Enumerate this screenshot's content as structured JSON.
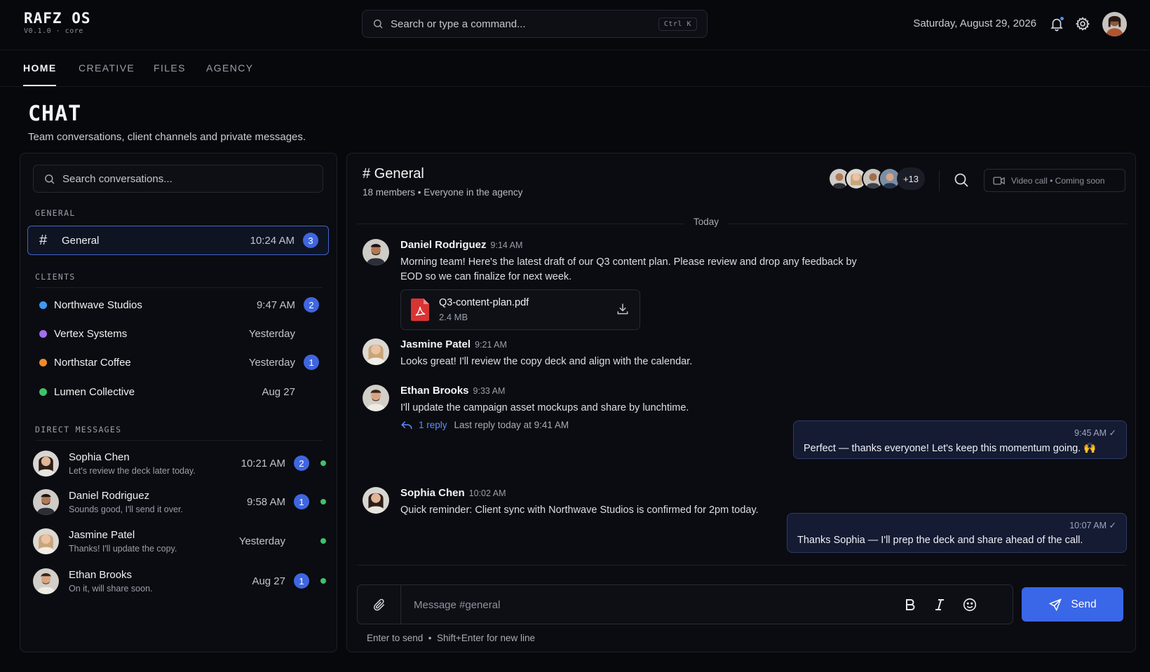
{
  "brand": {
    "name": "RAFZ OS",
    "version": "V0.1.0 · core"
  },
  "command_search": {
    "placeholder": "Search or type a command...",
    "shortcut": "Ctrl K"
  },
  "header": {
    "date": "Saturday, August 29, 2026"
  },
  "nav": {
    "tabs": [
      "HOME",
      "CREATIVE",
      "FILES",
      "AGENCY"
    ],
    "active": "HOME"
  },
  "page": {
    "title": "CHAT",
    "subtitle": "Team conversations, client channels and private messages."
  },
  "sidebar": {
    "search_placeholder": "Search conversations...",
    "sections": {
      "general": "GENERAL",
      "clients": "CLIENTS",
      "direct": "DIRECT MESSAGES"
    },
    "general": [
      {
        "name": "General",
        "time": "10:24 AM",
        "unread": "3"
      }
    ],
    "clients": [
      {
        "name": "Northwave Studios",
        "time": "9:47 AM",
        "unread": "2",
        "color": "#3d9bf0"
      },
      {
        "name": "Vertex Systems",
        "time": "Yesterday",
        "unread": "",
        "color": "#a46ff0"
      },
      {
        "name": "Northstar Coffee",
        "time": "Yesterday",
        "unread": "1",
        "color": "#f08a2b"
      },
      {
        "name": "Lumen Collective",
        "time": "Aug 27",
        "unread": "",
        "color": "#3ec268"
      }
    ],
    "direct": [
      {
        "name": "Sophia Chen",
        "preview": "Let's review the deck later today.",
        "time": "10:21 AM",
        "unread": "2"
      },
      {
        "name": "Daniel Rodriguez",
        "preview": "Sounds good, I'll send it over.",
        "time": "9:58 AM",
        "unread": "1"
      },
      {
        "name": "Jasmine Patel",
        "preview": "Thanks! I'll update the copy.",
        "time": "Yesterday",
        "unread": ""
      },
      {
        "name": "Ethan Brooks",
        "preview": "On it, will share soon.",
        "time": "Aug 27",
        "unread": "1"
      }
    ]
  },
  "channel": {
    "title": "# General",
    "subtitle": "18 members • Everyone in the agency",
    "extra_members": "+13",
    "video_call": "Video call • Coming soon"
  },
  "messages": {
    "day": "Today",
    "m1": {
      "author": "Daniel Rodriguez",
      "time": "9:14 AM",
      "text": "Morning team! Here's the latest draft of our Q3 content plan. Please review and drop any feedback by EOD so we can finalize for next week."
    },
    "file": {
      "name": "Q3-content-plan.pdf",
      "size": "2.4 MB"
    },
    "m2": {
      "author": "Jasmine Patel",
      "time": "9:21 AM",
      "text": "Looks great! I'll review the copy deck and align with the calendar."
    },
    "m3": {
      "author": "Ethan Brooks",
      "time": "9:33 AM",
      "text": "I'll update the campaign asset mockups and share by lunchtime."
    },
    "reply": {
      "link": "1 reply",
      "meta": "Last reply today at 9:41 AM"
    },
    "own1": {
      "time": "9:45 AM",
      "text": "Perfect — thanks everyone! Let's keep this momentum going. 🙌"
    },
    "m4": {
      "author": "Sophia Chen",
      "time": "10:02 AM",
      "text": "Quick reminder: Client sync with Northwave Studios is confirmed for 2pm today."
    },
    "own2": {
      "time": "10:07 AM",
      "text": "Thanks Sophia — I'll prep the deck and share ahead of the call."
    }
  },
  "composer": {
    "placeholder": "Message #general",
    "send": "Send",
    "hint": "Enter to send  •  Shift+Enter for new line"
  },
  "colors": {
    "accent": "#3a66e8",
    "online": "#3ec268",
    "background": "#07080c"
  }
}
